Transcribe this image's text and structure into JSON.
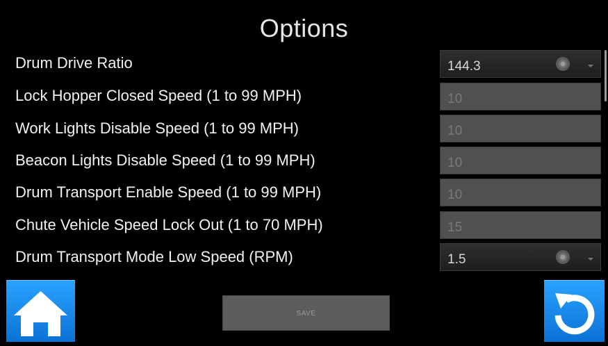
{
  "title": "Options",
  "rows": [
    {
      "label": "Drum Drive Ratio",
      "value": "144.3",
      "control": "dropdown"
    },
    {
      "label": "Lock Hopper Closed Speed (1 to 99 MPH)",
      "value": "10",
      "control": "text"
    },
    {
      "label": "Work Lights Disable Speed (1 to 99 MPH)",
      "value": "10",
      "control": "text"
    },
    {
      "label": "Beacon Lights Disable Speed (1 to 99 MPH)",
      "value": "10",
      "control": "text"
    },
    {
      "label": "Drum Transport Enable Speed (1 to 99 MPH)",
      "value": "10",
      "control": "text"
    },
    {
      "label": "Chute Vehicle Speed Lock Out (1 to 70 MPH)",
      "value": "15",
      "control": "text"
    },
    {
      "label": "Drum Transport Mode Low Speed (RPM)",
      "value": "1.5",
      "control": "dropdown"
    }
  ],
  "buttons": {
    "save_label": "SAVE",
    "home_icon": "home-icon",
    "refresh_icon": "refresh-icon"
  },
  "colors": {
    "accent": "#1e8ff0",
    "field_bg": "#505050",
    "background": "#000000"
  }
}
